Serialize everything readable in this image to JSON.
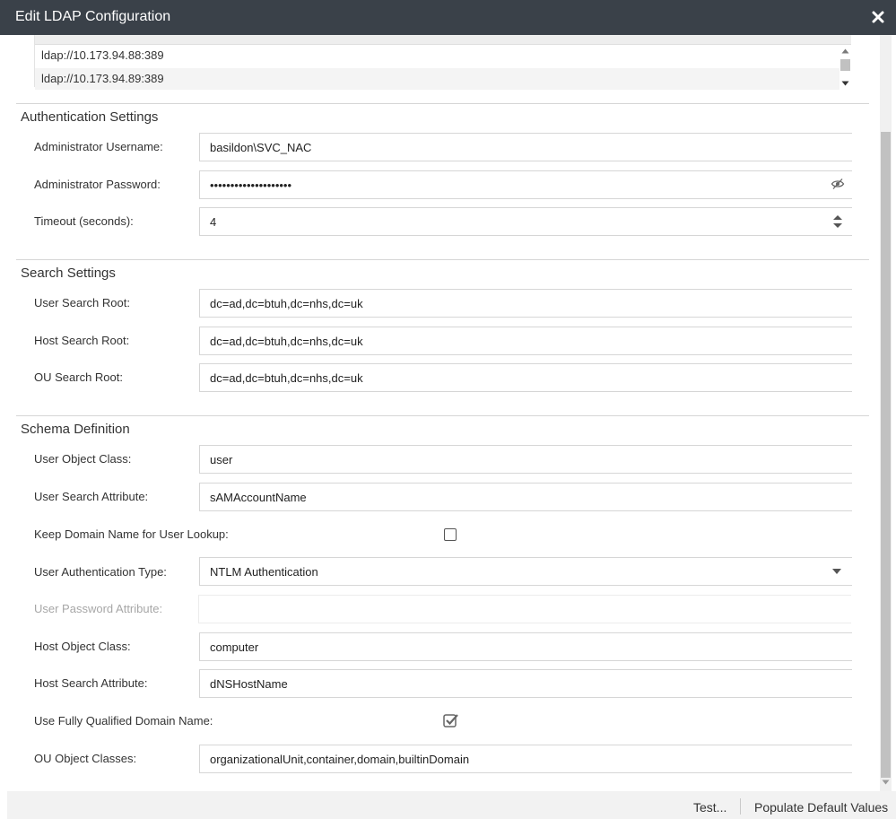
{
  "dialog": {
    "title": "Edit LDAP Configuration",
    "close_icon": "close-icon"
  },
  "server_list": {
    "items": [
      "ldap://10.173.94.88:389",
      "ldap://10.173.94.89:389"
    ]
  },
  "auth": {
    "heading": "Authentication Settings",
    "admin_username_label": "Administrator Username:",
    "admin_username_value": "basildon\\SVC_NAC",
    "admin_password_label": "Administrator Password:",
    "admin_password_value": "••••••••••••••••••••",
    "password_toggle_icon": "eye-slash-icon",
    "timeout_label": "Timeout (seconds):",
    "timeout_value": "4",
    "timeout_spinner_icon": "spinner-arrows-icon"
  },
  "search": {
    "heading": "Search Settings",
    "user_root_label": "User Search Root:",
    "user_root_value": "dc=ad,dc=btuh,dc=nhs,dc=uk",
    "host_root_label": "Host Search Root:",
    "host_root_value": "dc=ad,dc=btuh,dc=nhs,dc=uk",
    "ou_root_label": "OU Search Root:",
    "ou_root_value": "dc=ad,dc=btuh,dc=nhs,dc=uk"
  },
  "schema": {
    "heading": "Schema Definition",
    "user_object_class_label": "User Object Class:",
    "user_object_class_value": "user",
    "user_search_attr_label": "User Search Attribute:",
    "user_search_attr_value": "sAMAccountName",
    "keep_domain_label": "Keep Domain Name for User Lookup:",
    "keep_domain_checked": false,
    "user_auth_type_label": "User Authentication Type:",
    "user_auth_type_value": "NTLM Authentication",
    "user_password_attr_label": "User Password Attribute:",
    "user_password_attr_value": "",
    "host_object_class_label": "Host Object Class:",
    "host_object_class_value": "computer",
    "host_search_attr_label": "Host Search Attribute:",
    "host_search_attr_value": "dNSHostName",
    "use_fqdn_label": "Use Fully Qualified Domain Name:",
    "use_fqdn_checked": true,
    "ou_object_classes_label": "OU Object Classes:",
    "ou_object_classes_value": "organizationalUnit,container,domain,builtinDomain"
  },
  "footer": {
    "test_label": "Test...",
    "populate_label": "Populate Default Values"
  }
}
